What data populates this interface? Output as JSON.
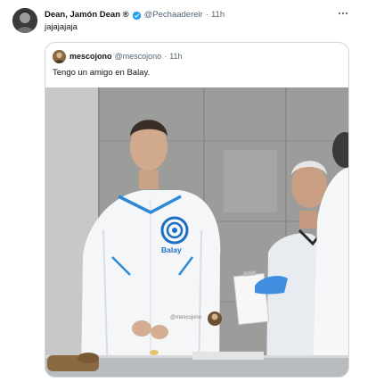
{
  "tweet": {
    "display_name": "Dean, Jamón Dean ®",
    "handle": "@Pechaadereir",
    "separator": "·",
    "time": "11h",
    "text": "jajajajaja",
    "icons": {
      "avatar": "user-avatar",
      "verified": "verified-badge-icon",
      "more": "more-options-icon"
    }
  },
  "quote": {
    "display_name": "mescojono",
    "handle": "@mescojono",
    "separator": "·",
    "time": "11h",
    "text": "Tengo un amigo en Balay.",
    "photo": {
      "logo_text": "Balay",
      "watermark": "@mescojono"
    }
  },
  "colors": {
    "accent_blue": "#1d9bf0",
    "secondary_text": "#536471",
    "border": "#cfd9de",
    "logo_blue": "#1d6fc4"
  }
}
